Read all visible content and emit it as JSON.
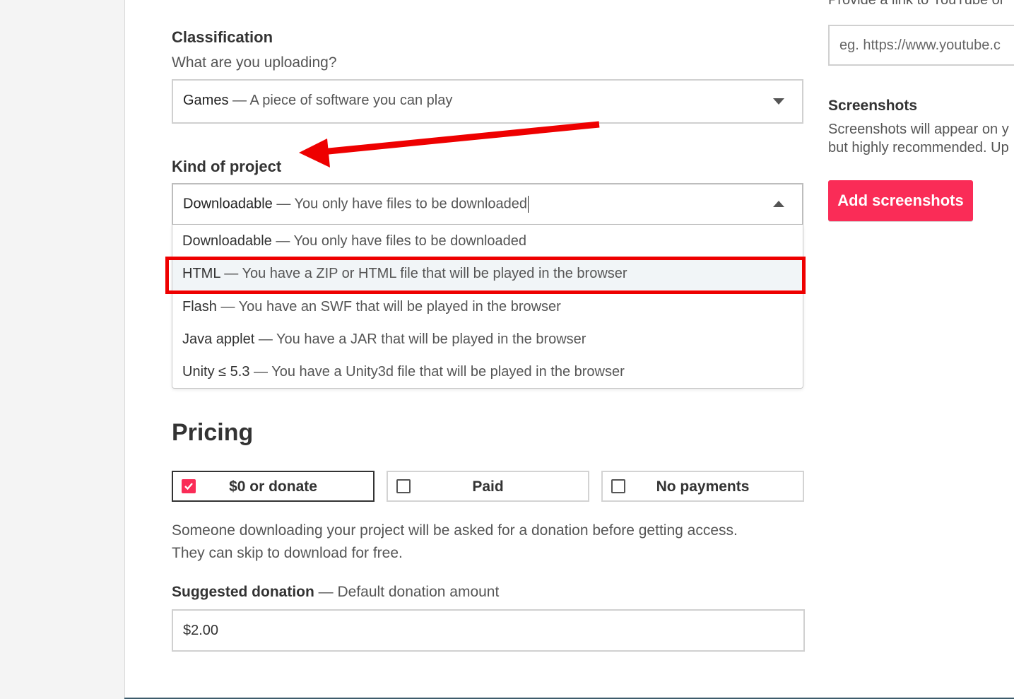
{
  "classification": {
    "label": "Classification",
    "question": "What are you uploading?",
    "selected_key": "Games",
    "selected_desc": " — A piece of software you can play"
  },
  "kind": {
    "label": "Kind of project",
    "selected_key": "Downloadable",
    "selected_desc": " — You only have files to be downloaded",
    "options": [
      {
        "key": "Downloadable",
        "desc": " — You only have files to be downloaded"
      },
      {
        "key": "HTML",
        "desc": " — You have a ZIP or HTML file that will be played in the browser"
      },
      {
        "key": "Flash",
        "desc": " — You have an SWF that will be played in the browser"
      },
      {
        "key": "Java applet",
        "desc": " — You have a JAR that will be played in the browser"
      },
      {
        "key": "Unity ≤ 5.3",
        "desc": " — You have a Unity3d file that will be played in the browser"
      }
    ]
  },
  "pricing": {
    "title": "Pricing",
    "options": [
      "$0 or donate",
      "Paid",
      "No payments"
    ],
    "selected": "$0 or donate",
    "help_line1": "Someone downloading your project will be asked for a donation before getting access.",
    "help_line2": "They can skip to download for free.",
    "suggested_label": "Suggested donation",
    "suggested_desc": " — Default donation amount",
    "suggested_value": "$2.00"
  },
  "sidebar": {
    "video_prompt": "Provide a link to YouTube or",
    "video_placeholder": "eg. https://www.youtube.c",
    "screenshots_label": "Screenshots",
    "screenshots_help1": "Screenshots will appear on y",
    "screenshots_help2": "but highly recommended. Up",
    "add_screenshots_label": "Add screenshots"
  },
  "colors": {
    "accent": "#fa2c57",
    "annotation": "#ee0000"
  }
}
